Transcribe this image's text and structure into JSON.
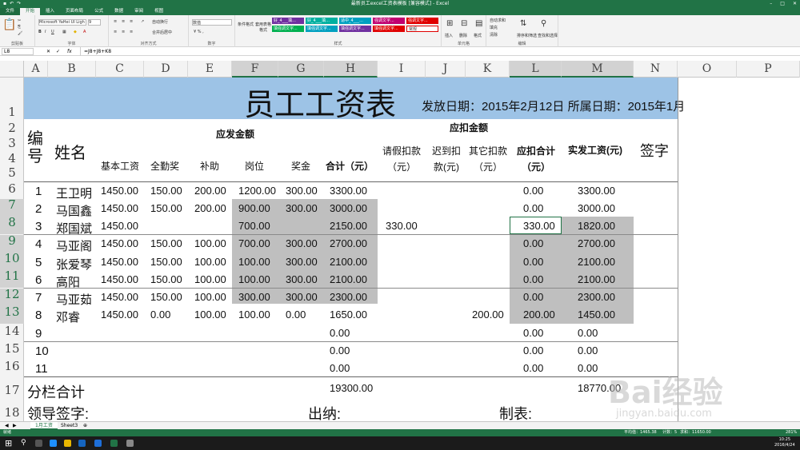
{
  "titlebar": {
    "title": "最新员工excel工资表模板 [兼容模式] - Excel"
  },
  "tabs": [
    "文件",
    "开始",
    "插入",
    "页面布局",
    "公式",
    "数据",
    "审阅",
    "视图"
  ],
  "ribbon": {
    "font_name": "Microsoft YaHei UI Ligh",
    "font_size": "9",
    "number_format": "数值",
    "wrap_text": "自动换行",
    "merge_center": "合并后居中",
    "cond_format": "条件格式",
    "table_format": "套用表格格式",
    "style_cells": [
      "好_4___填...",
      "好_4___填...",
      "适中_4___...",
      "强调文字...",
      "填强调文字...",
      "填强调文字...",
      "填强调文字...",
      "填强调文字...",
      "强调文字..."
    ],
    "style_normal": "常规",
    "insert": "插入",
    "delete": "删除",
    "format": "格式",
    "autosum": "自动求和",
    "fill": "填充",
    "clear": "清除",
    "sort_filter": "排序和筛选",
    "find_select": "查找和选择",
    "groups": [
      "剪贴板",
      "字体",
      "对齐方式",
      "数字",
      "样式",
      "单元格",
      "编辑"
    ]
  },
  "formula_bar": {
    "name_box": "L8",
    "formula": "=J8+J8+K8"
  },
  "columns": [
    "A",
    "B",
    "C",
    "D",
    "E",
    "F",
    "G",
    "H",
    "I",
    "J",
    "K",
    "L",
    "M",
    "N",
    "O",
    "P"
  ],
  "rows": [
    "1",
    "2",
    "3",
    "4",
    "5",
    "6",
    "7",
    "8",
    "9",
    "10",
    "11",
    "12",
    "13",
    "14",
    "15",
    "16",
    "17",
    "18"
  ],
  "sheet": {
    "title": "员工工资表",
    "dates": "发放日期：2015年2月12日 所属日期：2015年1月",
    "h_id": "编号",
    "h_name": "姓名",
    "h_pay_group": "应发金额",
    "h_deduct_group": "应扣金额",
    "h_base": "基本工资",
    "h_attend": "全勤奖",
    "h_subsidy": "补助",
    "h_post": "岗位",
    "h_bonus": "奖金",
    "h_total": "合计（元）",
    "h_leave": "请假扣款（元）",
    "h_late": "迟到扣款(元)",
    "h_other": "其它扣款（元）",
    "h_dtotal": "应扣合计（元）",
    "h_net": "实发工资(元)",
    "h_sign": "签字",
    "rows": [
      {
        "id": "1",
        "name": "王卫明",
        "base": "1450.00",
        "attend": "150.00",
        "subsidy": "200.00",
        "post": "1200.00",
        "bonus": "300.00",
        "total": "3300.00",
        "leave": "",
        "late": "",
        "other": "",
        "dtotal": "0.00",
        "net": "3300.00"
      },
      {
        "id": "2",
        "name": "马国鑫",
        "base": "1450.00",
        "attend": "150.00",
        "subsidy": "200.00",
        "post": "900.00",
        "bonus": "300.00",
        "total": "3000.00",
        "leave": "",
        "late": "",
        "other": "",
        "dtotal": "0.00",
        "net": "3000.00"
      },
      {
        "id": "3",
        "name": "郑国斌",
        "base": "1450.00",
        "attend": "",
        "subsidy": "",
        "post": "700.00",
        "bonus": "",
        "total": "2150.00",
        "leave": "330.00",
        "late": "",
        "other": "",
        "dtotal": "330.00",
        "net": "1820.00"
      },
      {
        "id": "4",
        "name": "马亚阁",
        "base": "1450.00",
        "attend": "150.00",
        "subsidy": "100.00",
        "post": "700.00",
        "bonus": "300.00",
        "total": "2700.00",
        "leave": "",
        "late": "",
        "other": "",
        "dtotal": "0.00",
        "net": "2700.00"
      },
      {
        "id": "5",
        "name": "张爱琴",
        "base": "1450.00",
        "attend": "150.00",
        "subsidy": "100.00",
        "post": "100.00",
        "bonus": "300.00",
        "total": "2100.00",
        "leave": "",
        "late": "",
        "other": "",
        "dtotal": "0.00",
        "net": "2100.00"
      },
      {
        "id": "6",
        "name": "高阳",
        "base": "1450.00",
        "attend": "150.00",
        "subsidy": "100.00",
        "post": "100.00",
        "bonus": "300.00",
        "total": "2100.00",
        "leave": "",
        "late": "",
        "other": "",
        "dtotal": "0.00",
        "net": "2100.00"
      },
      {
        "id": "7",
        "name": "马亚茹",
        "base": "1450.00",
        "attend": "150.00",
        "subsidy": "100.00",
        "post": "300.00",
        "bonus": "300.00",
        "total": "2300.00",
        "leave": "",
        "late": "",
        "other": "",
        "dtotal": "0.00",
        "net": "2300.00"
      },
      {
        "id": "8",
        "name": "邓睿",
        "base": "1450.00",
        "attend": "0.00",
        "subsidy": "100.00",
        "post": "100.00",
        "bonus": "0.00",
        "total": "1650.00",
        "leave": "",
        "late": "",
        "other": "200.00",
        "dtotal": "200.00",
        "net": "1450.00"
      },
      {
        "id": "9",
        "name": "",
        "base": "",
        "attend": "",
        "subsidy": "",
        "post": "",
        "bonus": "",
        "total": "0.00",
        "leave": "",
        "late": "",
        "other": "",
        "dtotal": "0.00",
        "net": "0.00"
      },
      {
        "id": "10",
        "name": "",
        "base": "",
        "attend": "",
        "subsidy": "",
        "post": "",
        "bonus": "",
        "total": "0.00",
        "leave": "",
        "late": "",
        "other": "",
        "dtotal": "0.00",
        "net": "0.00"
      },
      {
        "id": "11",
        "name": "",
        "base": "",
        "attend": "",
        "subsidy": "",
        "post": "",
        "bonus": "",
        "total": "0.00",
        "leave": "",
        "late": "",
        "other": "",
        "dtotal": "0.00",
        "net": "0.00"
      }
    ],
    "subtotal_label": "分栏合计",
    "subtotal_total": "19300.00",
    "subtotal_net": "18770.00",
    "leader_sign": "领导签字:",
    "cashier": "出纳:",
    "preparer": "制表:"
  },
  "sheet_tabs": [
    "1月工资",
    "Sheet3"
  ],
  "status": {
    "ready": "就绪",
    "average": "平均值：1465.38",
    "count": "计数：5",
    "sum": "求和：11650.00",
    "zoom": "281%"
  },
  "taskbar": {
    "time": "10:25",
    "date": "2016/4/24"
  },
  "watermark": {
    "brand": "Bai经验",
    "url": "jingyan.baidu.com"
  },
  "colors": {
    "excel_green": "#217346",
    "title_fill": "#9dc3e6",
    "highlight": "#bfbfbf"
  }
}
